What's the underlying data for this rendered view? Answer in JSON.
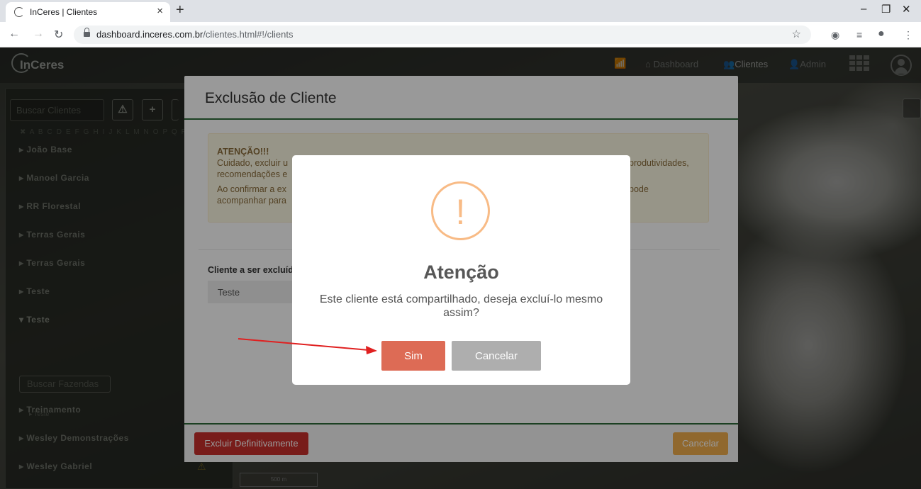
{
  "browser": {
    "tab_title": "InCeres | Clientes",
    "tab_close": "×",
    "new_tab": "+",
    "url_host": "dashboard.inceres.com.br",
    "url_path": "/clientes.html#!/clients",
    "window_controls": [
      "–",
      "❐",
      "✕"
    ]
  },
  "topnav": {
    "logo": "InCeres",
    "items": [
      {
        "label": "Dashboard",
        "icon": "dashboard-icon"
      },
      {
        "label": "Clientes",
        "icon": "users-icon"
      },
      {
        "label": "Admin",
        "icon": "admin-icon"
      }
    ]
  },
  "sidebar": {
    "search_placeholder": "Buscar Clientes",
    "alphabet": "✖ A B C D E F G H I J K L M N O P Q R S T U V",
    "clients": [
      "João Base",
      "Manoel Garcia",
      "RR Florestal",
      "Terras Gerais",
      "Terras Gerais",
      "Teste",
      "Teste",
      "Treinamento",
      "Wesley Demonstrações",
      "Wesley Gabriel"
    ],
    "farm_search_placeholder": "Buscar Fazendas",
    "farm_item": "Teste",
    "scale_label": "500 m"
  },
  "exclusion_modal": {
    "title": "Exclusão de Cliente",
    "alert_heading": "ATENÇÃO!!!",
    "alert_line1": "Cuidado, excluir u",
    "alert_line1_tail": "produtividades,",
    "alert_line2": "recomendações e",
    "alert_line3": "Ao confirmar a ex",
    "alert_line3_tail": "pode",
    "alert_line4": "acompanhar para",
    "client_label": "Cliente a ser excluíd",
    "client_value": "Teste",
    "delete_button": "Excluir Definitivamente",
    "cancel_button": "Cancelar"
  },
  "confirm_dialog": {
    "icon_symbol": "!",
    "title": "Atenção",
    "message": "Este cliente está compartilhado, deseja excluí-lo mesmo assim?",
    "confirm_button": "Sim",
    "cancel_button": "Cancelar"
  },
  "colors": {
    "confirm": "#dd6b55",
    "cancel": "#aeaeae",
    "danger": "#c9302c",
    "warning": "#f0ad4e",
    "brand_green": "#2e6b3a"
  }
}
